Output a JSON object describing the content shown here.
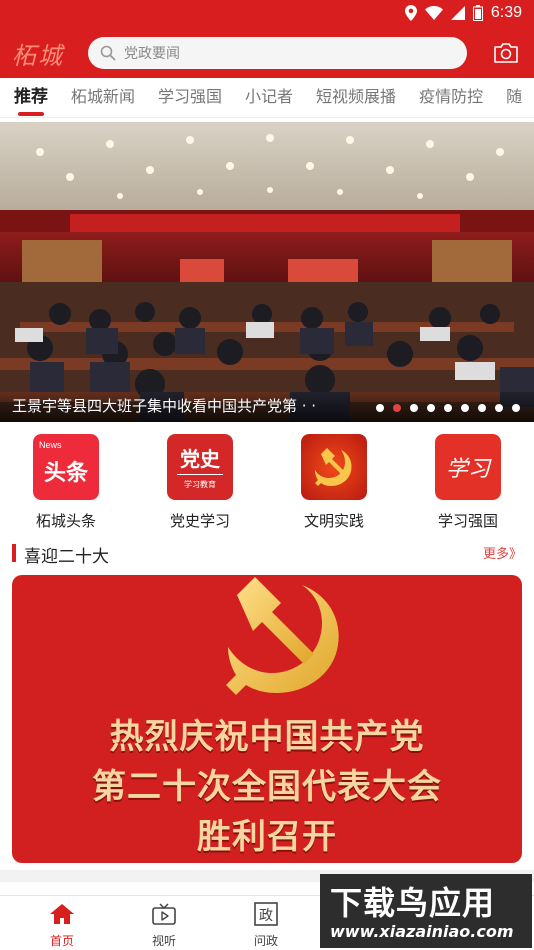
{
  "status_bar": {
    "time": "6:39"
  },
  "header": {
    "logo_text": "柘城",
    "search_placeholder": "党政要闻"
  },
  "tabs": [
    {
      "label": "推荐",
      "active": true
    },
    {
      "label": "柘城新闻"
    },
    {
      "label": "学习强国"
    },
    {
      "label": "小记者"
    },
    {
      "label": "短视频展播"
    },
    {
      "label": "疫情防控"
    },
    {
      "label": "随"
    }
  ],
  "banner": {
    "caption": "王景宇等县四大班子集中收看中国共产党第 · ·",
    "dot_count": 9,
    "active_dot": 1
  },
  "shortcuts": [
    {
      "label": "柘城头条",
      "icon_text": "头条",
      "icon_sub": "News"
    },
    {
      "label": "党史学习",
      "icon_text": "党史",
      "icon_sub": "学习教育"
    },
    {
      "label": "文明实践",
      "icon_text": ""
    },
    {
      "label": "学习强国",
      "icon_text": "学习"
    }
  ],
  "section": {
    "title": "喜迎二十大",
    "more": "更多》"
  },
  "feature": {
    "lines": [
      "热烈庆祝中国共产党",
      "第二十次全国代表大会",
      "胜利召开"
    ]
  },
  "bottom_nav": [
    {
      "label": "首页",
      "icon": "home-icon",
      "active": true
    },
    {
      "label": "视听",
      "icon": "tv-play-icon"
    },
    {
      "label": "问政",
      "icon": "zheng-icon",
      "icon_text": "政"
    }
  ],
  "watermark": {
    "title": "下载鸟应用",
    "url": "www.xiazainiao.com"
  },
  "colors": {
    "brand_red": "#d81e1e",
    "gold": "#f6d6a0"
  }
}
